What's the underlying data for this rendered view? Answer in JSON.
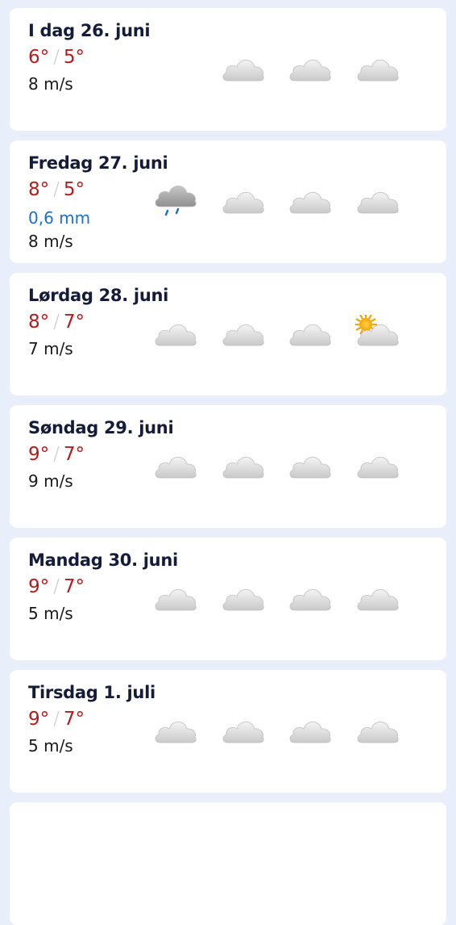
{
  "days": [
    {
      "title": "I dag 26. juni",
      "max": "6°",
      "min": "5°",
      "precip": "",
      "wind": "8 m/s",
      "icons": [
        "cloud-icon",
        "cloud-icon",
        "cloud-icon"
      ]
    },
    {
      "title": "Fredag 27. juni",
      "max": "8°",
      "min": "5°",
      "precip": "0,6 mm",
      "wind": "8 m/s",
      "icons": [
        "rain-cloud-icon",
        "cloud-icon",
        "cloud-icon",
        "cloud-icon"
      ]
    },
    {
      "title": "Lørdag 28. juni",
      "max": "8°",
      "min": "7°",
      "precip": "",
      "wind": "7 m/s",
      "icons": [
        "cloud-icon",
        "cloud-icon",
        "cloud-icon",
        "partly-sunny-icon"
      ]
    },
    {
      "title": "Søndag 29. juni",
      "max": "9°",
      "min": "7°",
      "precip": "",
      "wind": "9 m/s",
      "icons": [
        "cloud-icon",
        "cloud-icon",
        "cloud-icon",
        "cloud-icon"
      ]
    },
    {
      "title": "Mandag 30. juni",
      "max": "9°",
      "min": "7°",
      "precip": "",
      "wind": "5 m/s",
      "icons": [
        "cloud-icon",
        "cloud-icon",
        "cloud-icon",
        "cloud-icon"
      ]
    },
    {
      "title": "Tirsdag 1. juli",
      "max": "9°",
      "min": "7°",
      "precip": "",
      "wind": "5 m/s",
      "icons": [
        "cloud-icon",
        "cloud-icon",
        "cloud-icon",
        "cloud-icon"
      ]
    }
  ],
  "colors": {
    "background": "#e8eefa",
    "card": "#ffffff",
    "temperature": "#b71c1c",
    "precipitation": "#1b6fd1",
    "title": "#141c3a"
  }
}
